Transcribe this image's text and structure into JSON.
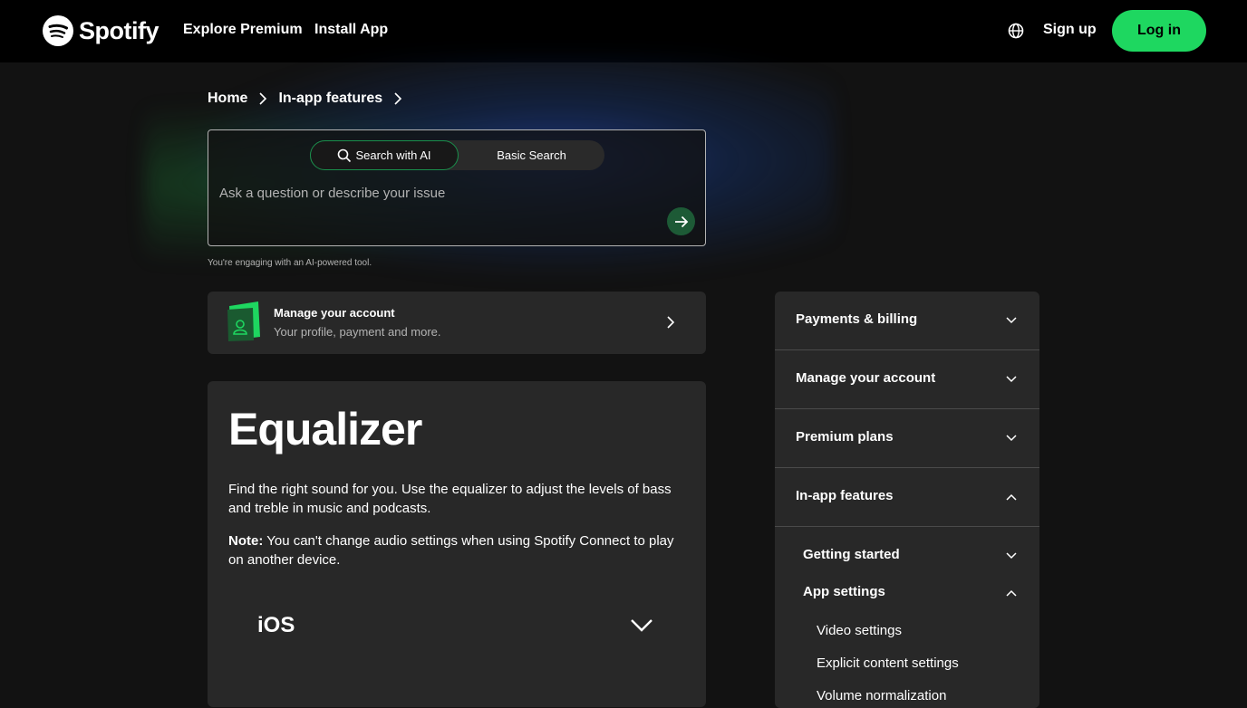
{
  "header": {
    "logo_text": "Spotify",
    "nav": [
      "Explore Premium",
      "Install App"
    ],
    "sign_up": "Sign up",
    "log_in": "Log in"
  },
  "breadcrumb": [
    "Home",
    "In-app features"
  ],
  "search": {
    "mode_ai": "Search with AI",
    "mode_basic": "Basic Search",
    "placeholder": "Ask a question or describe your issue",
    "ai_disclaimer": "You're engaging with an AI-powered tool."
  },
  "account_card": {
    "title": "Manage your account",
    "subtitle": "Your profile, payment and more."
  },
  "article": {
    "title": "Equalizer",
    "intro": "Find the right sound for you. Use the equalizer to adjust the levels of bass and treble in music and podcasts.",
    "note_label": "Note:",
    "note_text": " You can't change audio settings when using Spotify Connect to play on another device.",
    "platform": "iOS"
  },
  "sidebar": {
    "sections": [
      "Payments & billing",
      "Manage your account",
      "Premium plans",
      "In-app features"
    ],
    "subsections": [
      "Getting started",
      "App settings"
    ],
    "leaves": [
      "Video settings",
      "Explicit content settings",
      "Volume normalization"
    ]
  },
  "colors": {
    "brand_green": "#1ed760",
    "background": "#121212",
    "card": "#282828"
  }
}
